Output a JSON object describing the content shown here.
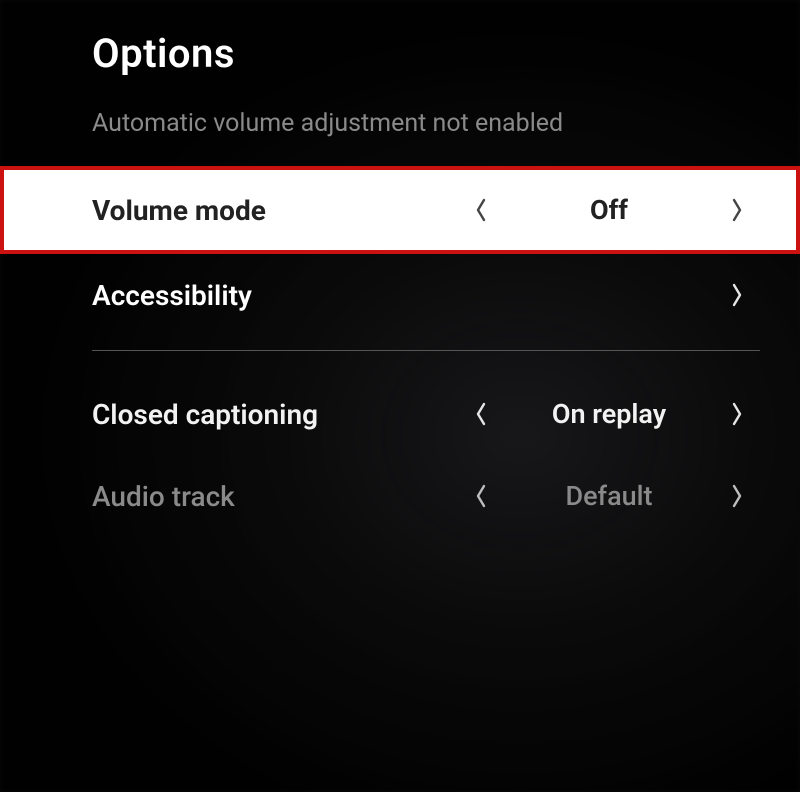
{
  "title": "Options",
  "description": "Automatic volume adjustment not enabled",
  "rows": {
    "volume_mode": {
      "label": "Volume mode",
      "value": "Off"
    },
    "accessibility": {
      "label": "Accessibility"
    },
    "closed_captioning": {
      "label": "Closed captioning",
      "value": "On replay"
    },
    "audio_track": {
      "label": "Audio track",
      "value": "Default"
    }
  }
}
